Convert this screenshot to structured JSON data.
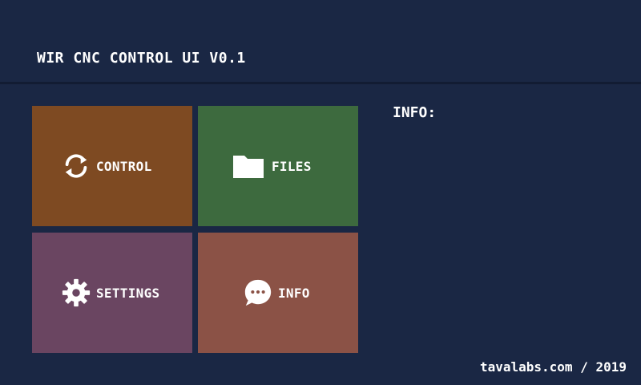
{
  "header": {
    "title": "WIR CNC CONTROL UI V0.1"
  },
  "tiles": [
    {
      "label": "CONTROL",
      "icon": "refresh-icon",
      "color": "#7e4a22"
    },
    {
      "label": "FILES",
      "icon": "folder-icon",
      "color": "#3d6a3e"
    },
    {
      "label": "SETTINGS",
      "icon": "gear-icon",
      "color": "#6a4561"
    },
    {
      "label": "INFO",
      "icon": "chat-bubble-icon",
      "color": "#8b5246"
    }
  ],
  "info_panel": {
    "heading": "INFO:"
  },
  "footer": {
    "credit": "tavalabs.com / 2019"
  },
  "theme": {
    "background": "#1a2744",
    "divider": "#121c33"
  }
}
